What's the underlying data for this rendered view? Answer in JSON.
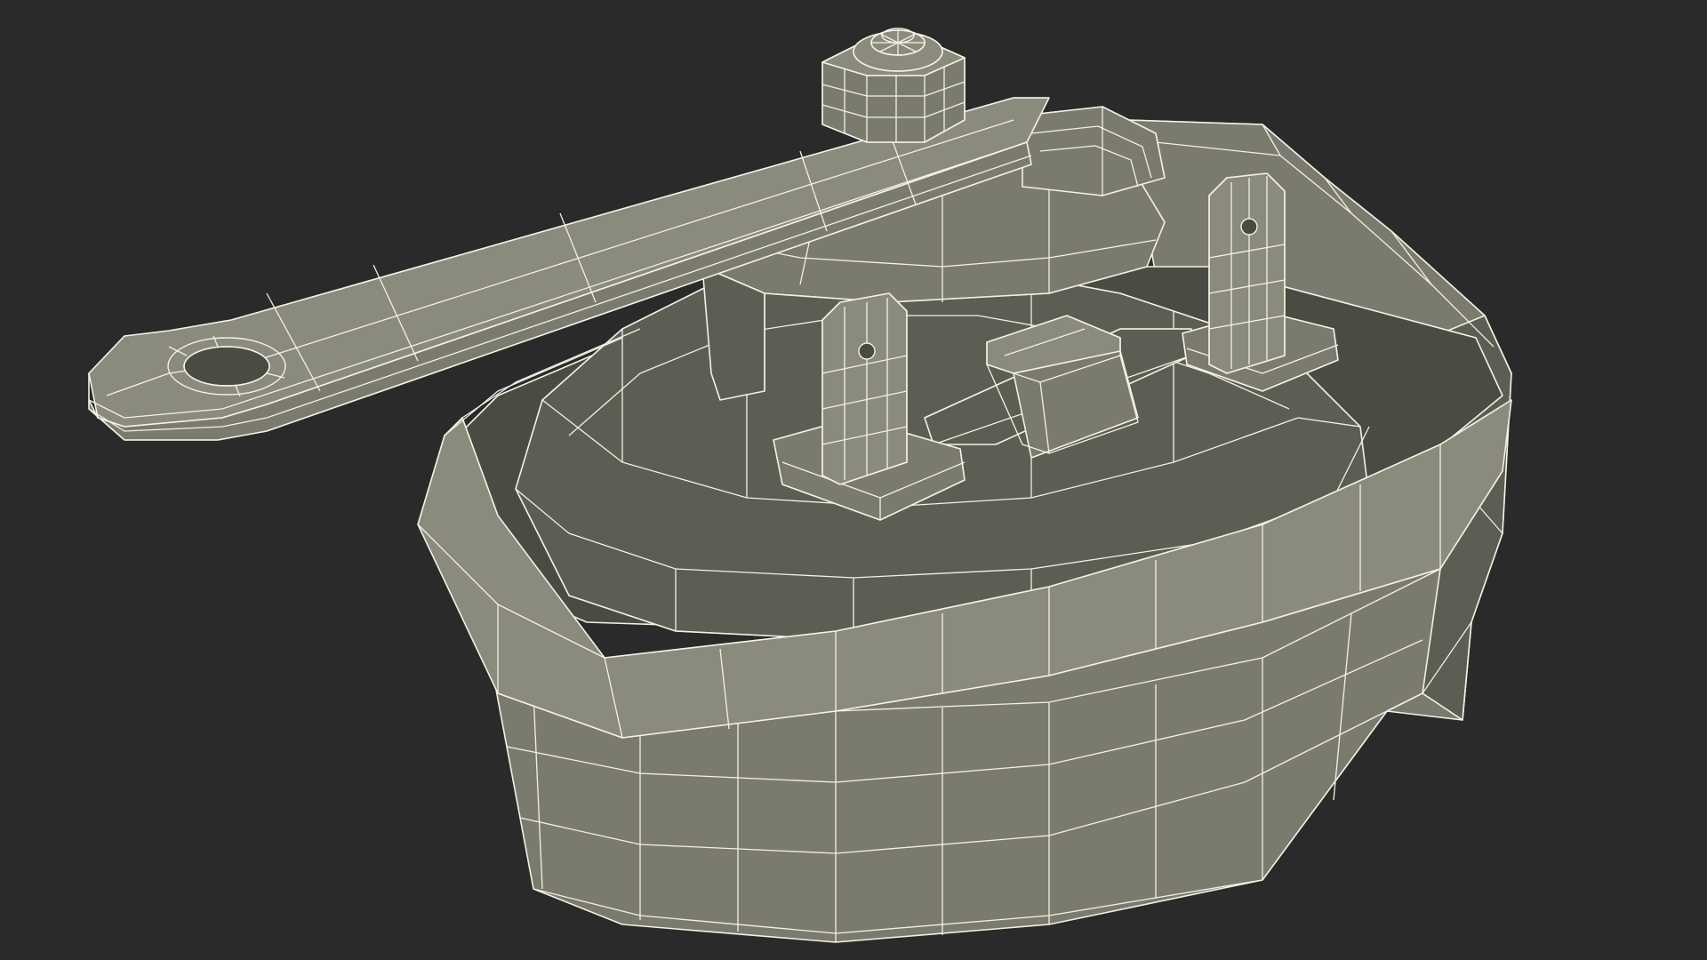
{
  "colors": {
    "background": "#2a2a2a",
    "surface_light": "#8a8b7d",
    "surface_mid": "#7a7b6e",
    "surface_dark": "#5d5e53",
    "surface_shadow": "#4a4b43",
    "wire": "#f3f1e4"
  }
}
